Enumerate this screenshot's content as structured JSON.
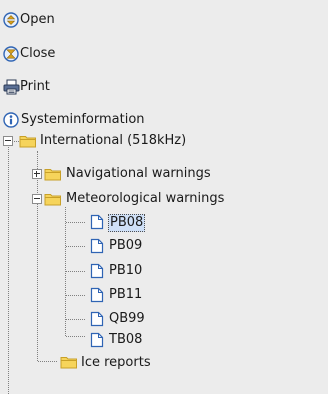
{
  "menu": {
    "open_label": "Open",
    "close_label": "Close",
    "print_label": "Print",
    "sysinfo_label": "Systeminformation"
  },
  "tree": {
    "root_label": "International (518kHz)",
    "nav_label": "Navigational warnings",
    "met_label": "Meteorological warnings",
    "met_items": [
      "PB08",
      "PB09",
      "PB10",
      "PB11",
      "QB99",
      "TB08"
    ],
    "ice_label": "Ice reports",
    "selected": "PB08"
  },
  "icons": {
    "open": "open-icon",
    "close": "close-icon",
    "print": "printer-icon",
    "info": "info-icon",
    "folder": "folder-icon",
    "document": "document-icon"
  },
  "colors": {
    "folder_fill": "#f6d45b",
    "folder_stroke": "#c8a028",
    "doc_stroke": "#2f64b4",
    "selection_bg": "#cfe0f7"
  }
}
